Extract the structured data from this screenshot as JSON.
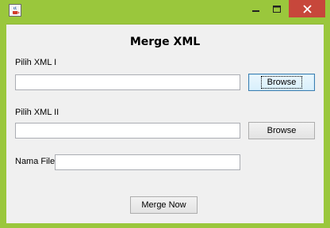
{
  "window": {
    "icon": "java-cup-icon",
    "controls": [
      "minimize-icon",
      "maximize-icon",
      "close-icon"
    ],
    "close_color": "#c7473b",
    "frame_color": "#9ac73c"
  },
  "form": {
    "title": "Merge XML",
    "xml1": {
      "label": "Pilih XML I",
      "value": "",
      "browse_label": "Browse"
    },
    "xml2": {
      "label": "Pilih XML II",
      "value": "",
      "browse_label": "Browse"
    },
    "filename": {
      "label": "Nama File",
      "value": ""
    },
    "merge_label": "Merge Now"
  }
}
